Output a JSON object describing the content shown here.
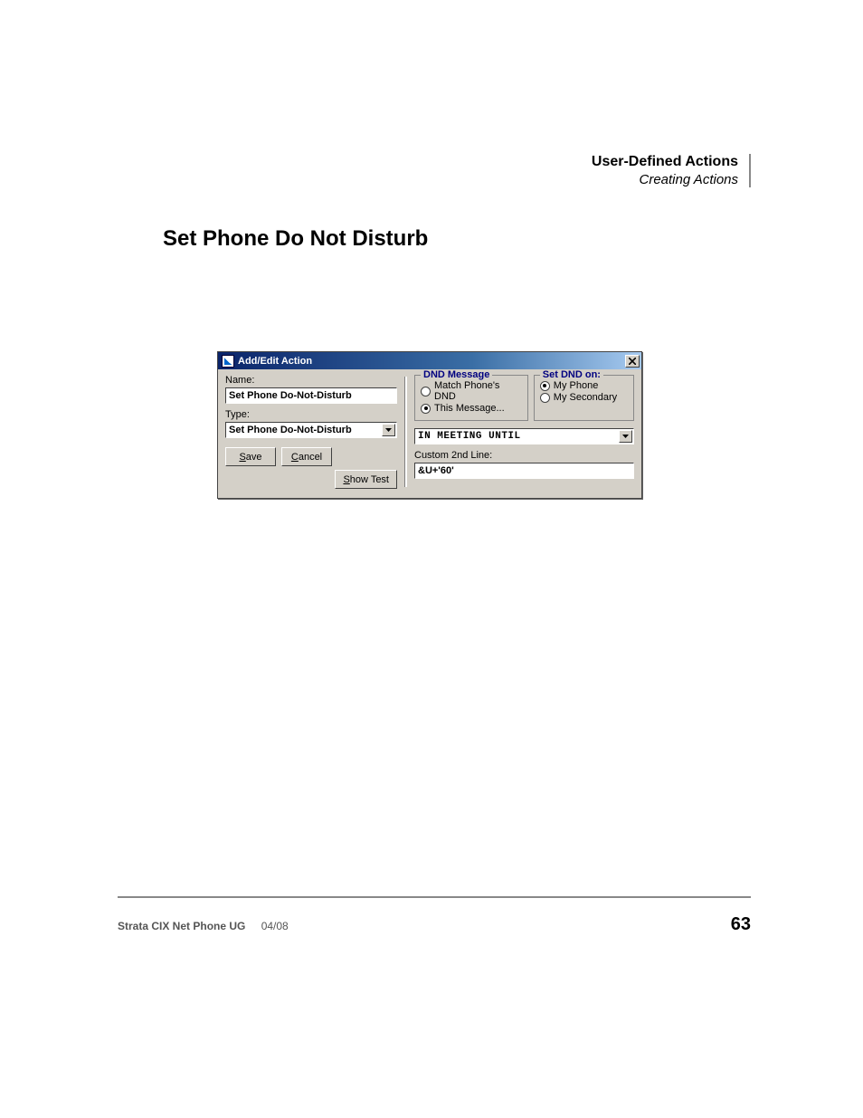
{
  "header": {
    "title": "User-Defined Actions",
    "subtitle": "Creating Actions"
  },
  "section_title": "Set Phone Do Not Disturb",
  "dialog": {
    "title": "Add/Edit Action",
    "name_label": "Name:",
    "name_value": "Set Phone Do-Not-Disturb",
    "type_label": "Type:",
    "type_value": "Set Phone Do-Not-Disturb",
    "save_btn_pre": "S",
    "save_btn_rest": "ave",
    "cancel_btn_pre": "C",
    "cancel_btn_rest": "ancel",
    "showtest_btn_pre": "S",
    "showtest_btn_rest": "how Test",
    "dnd_legend": "DND Message",
    "dnd_opt1": "Match Phone's DND",
    "dnd_opt2": "This Message...",
    "seton_legend": "Set DND on:",
    "seton_opt1": "My Phone",
    "seton_opt2": "My Secondary",
    "msg_combo": "IN MEETING UNTIL",
    "custom_label": "Custom 2nd Line:",
    "custom_value": "&U+'60'"
  },
  "footer": {
    "doc": "Strata CIX Net Phone UG",
    "date": "04/08",
    "page": "63"
  }
}
